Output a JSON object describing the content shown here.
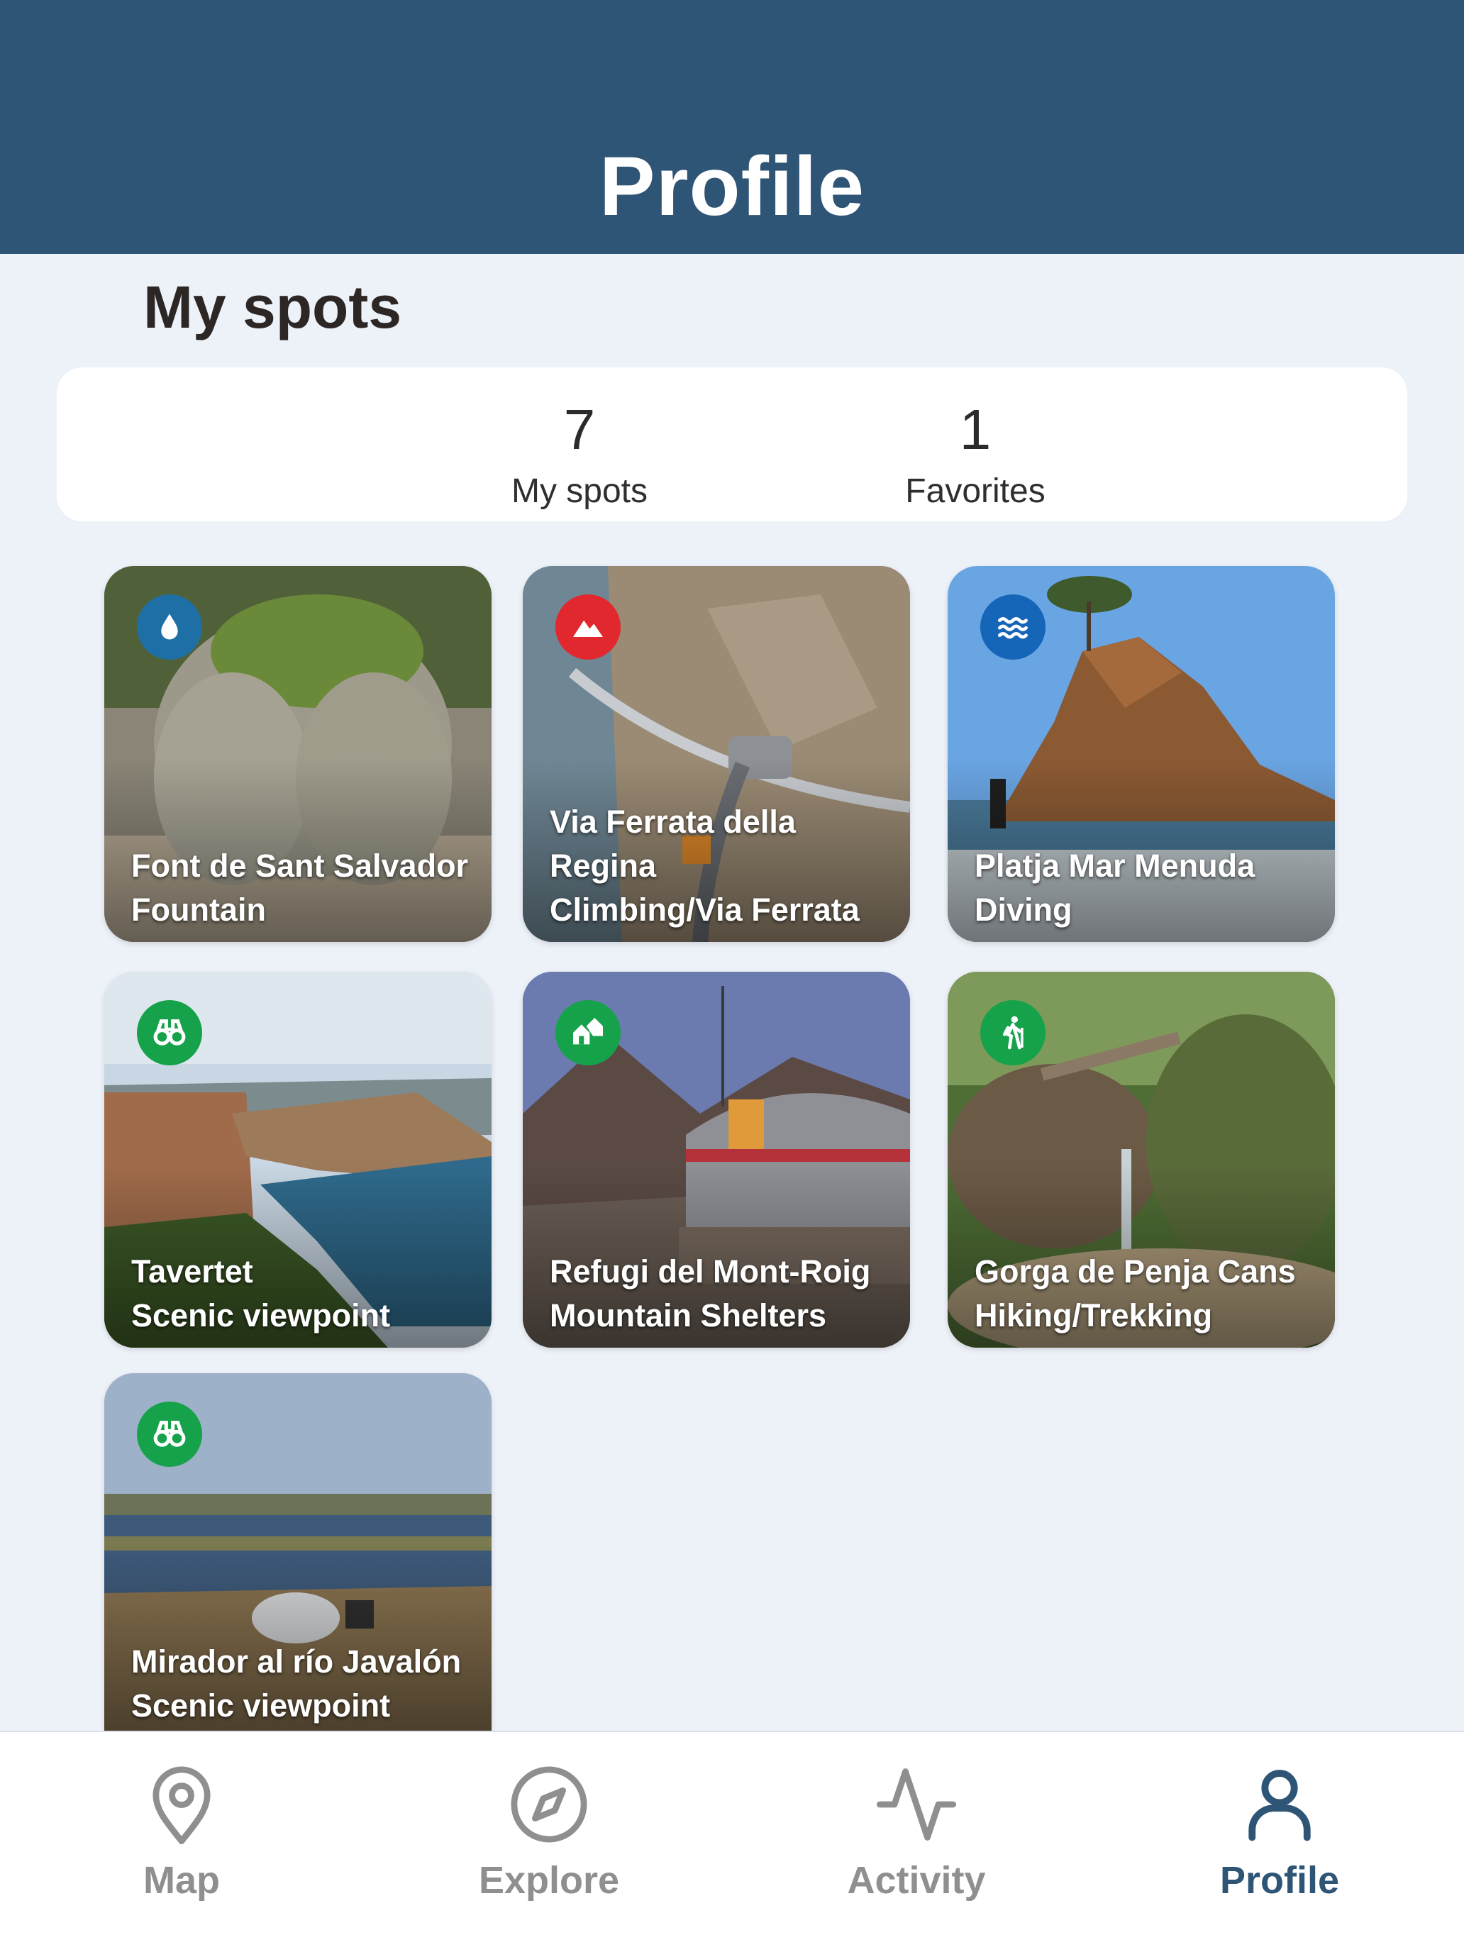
{
  "header": {
    "title": "Profile"
  },
  "section": {
    "title": "My spots"
  },
  "stats": [
    {
      "value": "7",
      "label": "My spots"
    },
    {
      "value": "1",
      "label": "Favorites"
    }
  ],
  "spots": [
    {
      "name": "Font de Sant Salvador",
      "category": "Fountain",
      "icon": "water-drop-icon",
      "badge_color": "#1d6fa5"
    },
    {
      "name_lines": [
        "Via Ferrata della",
        "Regina"
      ],
      "category": "Climbing/Via Ferrata",
      "icon": "mountain-icon",
      "badge_color": "#e0282e"
    },
    {
      "name": "Platja Mar Menuda",
      "category": "Diving",
      "icon": "waves-icon",
      "badge_color": "#1565b8"
    },
    {
      "name": "Tavertet",
      "category": "Scenic viewpoint",
      "icon": "binoculars-icon",
      "badge_color": "#16a24a"
    },
    {
      "name": "Refugi del Mont-Roig",
      "category": "Mountain Shelters",
      "icon": "houses-icon",
      "badge_color": "#16a24a"
    },
    {
      "name": "Gorga de Penja Cans",
      "category": "Hiking/Trekking",
      "icon": "hiker-icon",
      "badge_color": "#16a24a"
    },
    {
      "name": "Mirador al río Javalón",
      "category": "Scenic viewpoint",
      "icon": "binoculars-icon",
      "badge_color": "#16a24a"
    }
  ],
  "tabs": [
    {
      "label": "Map",
      "icon": "map-pin-icon",
      "active": false
    },
    {
      "label": "Explore",
      "icon": "compass-icon",
      "active": false
    },
    {
      "label": "Activity",
      "icon": "activity-icon",
      "active": false
    },
    {
      "label": "Profile",
      "icon": "user-icon",
      "active": true
    }
  ],
  "colors": {
    "header": "#2e5476",
    "background": "#edf1f8",
    "active_tab": "#2e5476",
    "inactive_tab": "#8f8f8f"
  }
}
